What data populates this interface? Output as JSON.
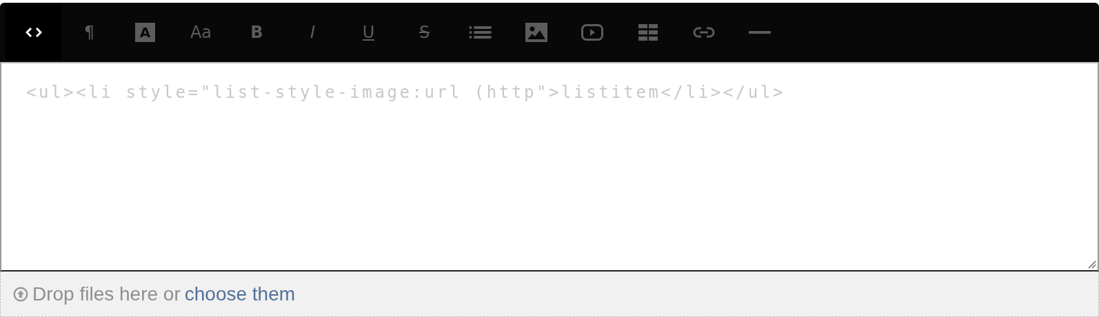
{
  "toolbar": [
    {
      "kind": "code",
      "selected": true
    },
    {
      "kind": "glyph",
      "glyph": "¶",
      "selected": false
    },
    {
      "kind": "boxed-glyph",
      "glyph": "A",
      "selected": false
    },
    {
      "kind": "glyph",
      "glyph": "Aa",
      "selected": false
    },
    {
      "kind": "bold",
      "glyph": "B",
      "selected": false
    },
    {
      "kind": "italic",
      "glyph": "I",
      "selected": false
    },
    {
      "kind": "underline",
      "glyph": "U",
      "selected": false
    },
    {
      "kind": "strike",
      "glyph": "S",
      "selected": false
    },
    {
      "kind": "list",
      "selected": false
    },
    {
      "kind": "image",
      "selected": false
    },
    {
      "kind": "video",
      "selected": false
    },
    {
      "kind": "table",
      "selected": false
    },
    {
      "kind": "link",
      "selected": false
    },
    {
      "kind": "rule",
      "selected": false
    }
  ],
  "editor": {
    "placeholder": "<ul><li style=\"list-style-image:url (http\">listitem</li></ul>"
  },
  "dropzone": {
    "text": "Drop files here or",
    "link": "choose them"
  }
}
